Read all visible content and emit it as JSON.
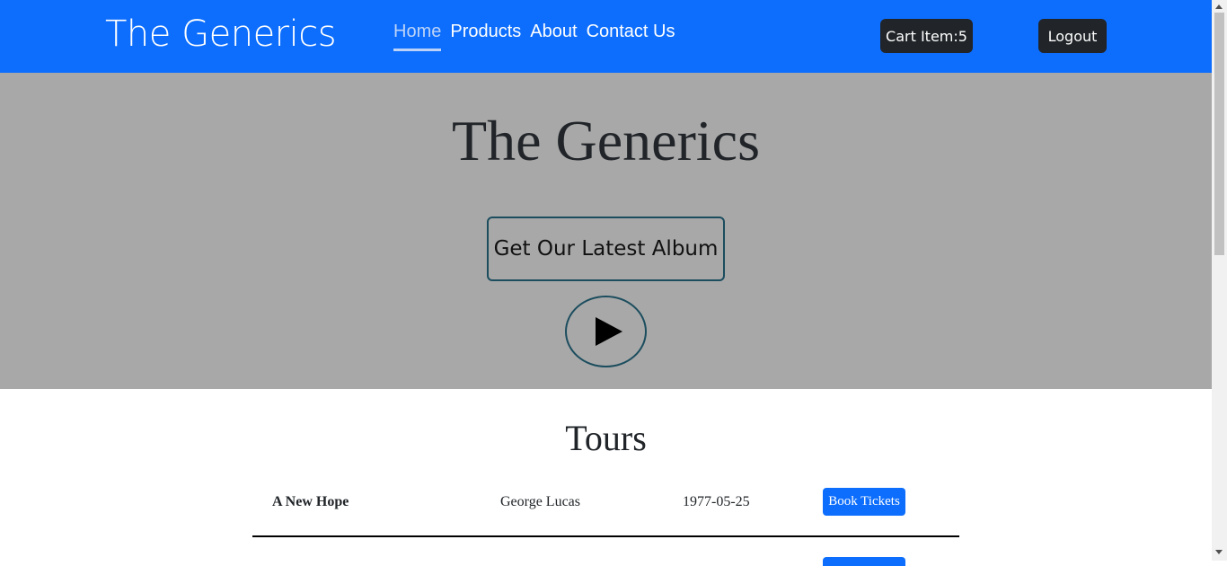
{
  "header": {
    "brand": "The Generics",
    "nav": [
      "Home",
      "Products",
      "About",
      "Contact Us"
    ],
    "active_nav": "Home",
    "cart_label": "Cart Item:5",
    "logout_label": "Logout"
  },
  "hero": {
    "title": "The Generics",
    "album_button": "Get Our Latest Album",
    "play_icon": "play-icon"
  },
  "tours": {
    "heading": "Tours",
    "rows": [
      {
        "title": "A New Hope",
        "director": "George Lucas",
        "date": "1977-05-25",
        "button": "Book Tickets"
      }
    ]
  },
  "colors": {
    "navbar": "#0d6efd",
    "hero_bg": "#a8a8a8",
    "button_dark": "#212529",
    "book_button": "#0d6efd"
  }
}
